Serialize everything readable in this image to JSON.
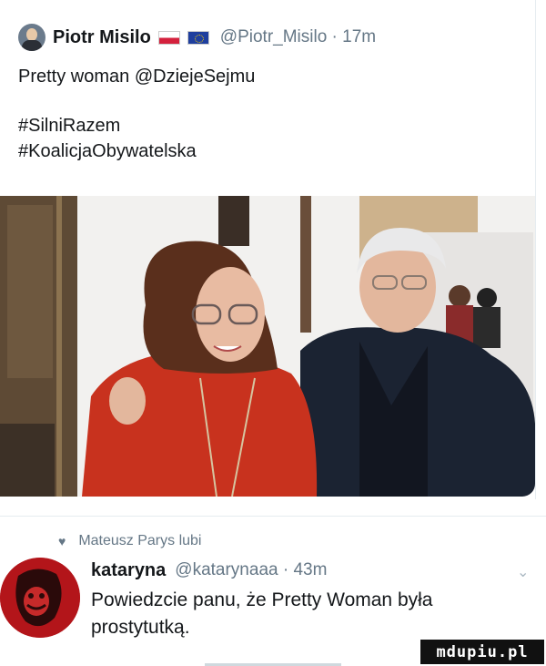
{
  "tweet": {
    "author_name": "Piotr Misilo",
    "handle_time": "@Piotr_Misilo · 17m",
    "text_line1": "Pretty woman @DziejeSejmu",
    "text_line2": "#SilniRazem",
    "text_line3": "#KoalicjaObywatelska",
    "icons": [
      "avatar",
      "poland-flag-icon",
      "eu-flag-icon"
    ]
  },
  "activity": {
    "liked_by": "Mateusz Parys lubi",
    "icon": "heart-icon"
  },
  "reply": {
    "author_name": "kataryna",
    "handle_time": "@katarynaaa · 43m",
    "text_line1": "Powiedzcie panu, że Pretty Woman była",
    "text_line2": "prostytutką.",
    "menu_icon": "chevron-down-icon"
  },
  "watermark": "mdupiu.pl",
  "colors": {
    "text": "#14171a",
    "secondary": "#657786",
    "divider": "#e6ecf0",
    "red_jacket": "#c8321e",
    "avatar_red": "#b3151a"
  }
}
